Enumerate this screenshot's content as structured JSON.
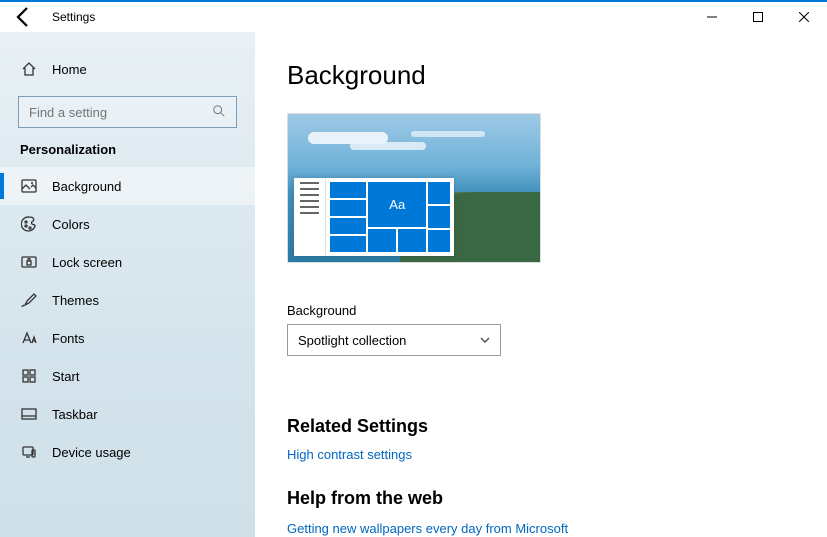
{
  "window": {
    "title": "Settings"
  },
  "sidebar": {
    "home": "Home",
    "search_placeholder": "Find a setting",
    "section": "Personalization",
    "items": [
      {
        "icon": "picture-icon",
        "label": "Background",
        "selected": true
      },
      {
        "icon": "palette-icon",
        "label": "Colors"
      },
      {
        "icon": "lock-icon",
        "label": "Lock screen"
      },
      {
        "icon": "brush-icon",
        "label": "Themes"
      },
      {
        "icon": "font-icon",
        "label": "Fonts"
      },
      {
        "icon": "grid-icon",
        "label": "Start"
      },
      {
        "icon": "taskbar-icon",
        "label": "Taskbar"
      },
      {
        "icon": "usage-icon",
        "label": "Device usage"
      }
    ]
  },
  "main": {
    "title": "Background",
    "preview_tile_label": "Aa",
    "background_label": "Background",
    "background_value": "Spotlight collection",
    "related_heading": "Related Settings",
    "related_link": "High contrast settings",
    "help_heading": "Help from the web",
    "help_links": [
      "Getting new wallpapers every day from Microsoft"
    ]
  }
}
